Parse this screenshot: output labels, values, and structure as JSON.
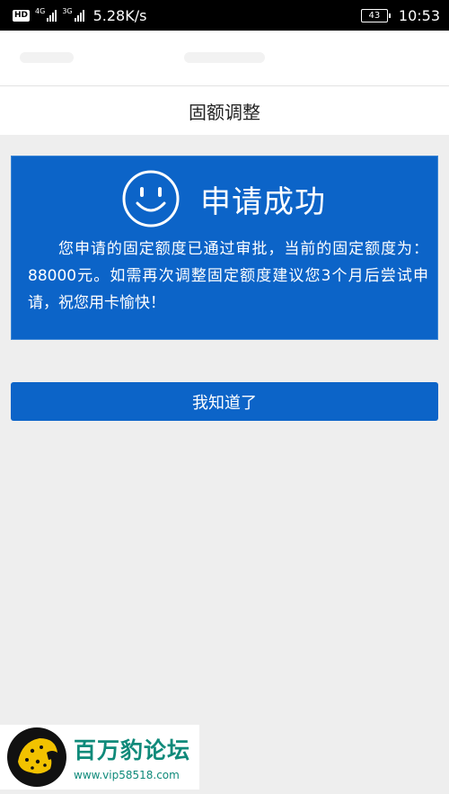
{
  "status_bar": {
    "hd": "HD",
    "net1": "4G",
    "net2": "3G",
    "speed": "5.28K/s",
    "battery": "43",
    "time": "10:53"
  },
  "header": {
    "title": "固额调整"
  },
  "result": {
    "icon": "smiley-icon",
    "title": "申请成功",
    "message": "您申请的固定额度已通过审批，当前的固定额度为：88000元。如需再次调整固定额度建议您3个月后尝试申请，祝您用卡愉快！"
  },
  "actions": {
    "ok_label": "我知道了"
  },
  "watermark": {
    "name": "百万豹论坛",
    "url": "www.vip58518.com"
  },
  "colors": {
    "primary": "#0c64c8",
    "background": "#eeeeee",
    "watermark_text": "#0f8a7a"
  }
}
